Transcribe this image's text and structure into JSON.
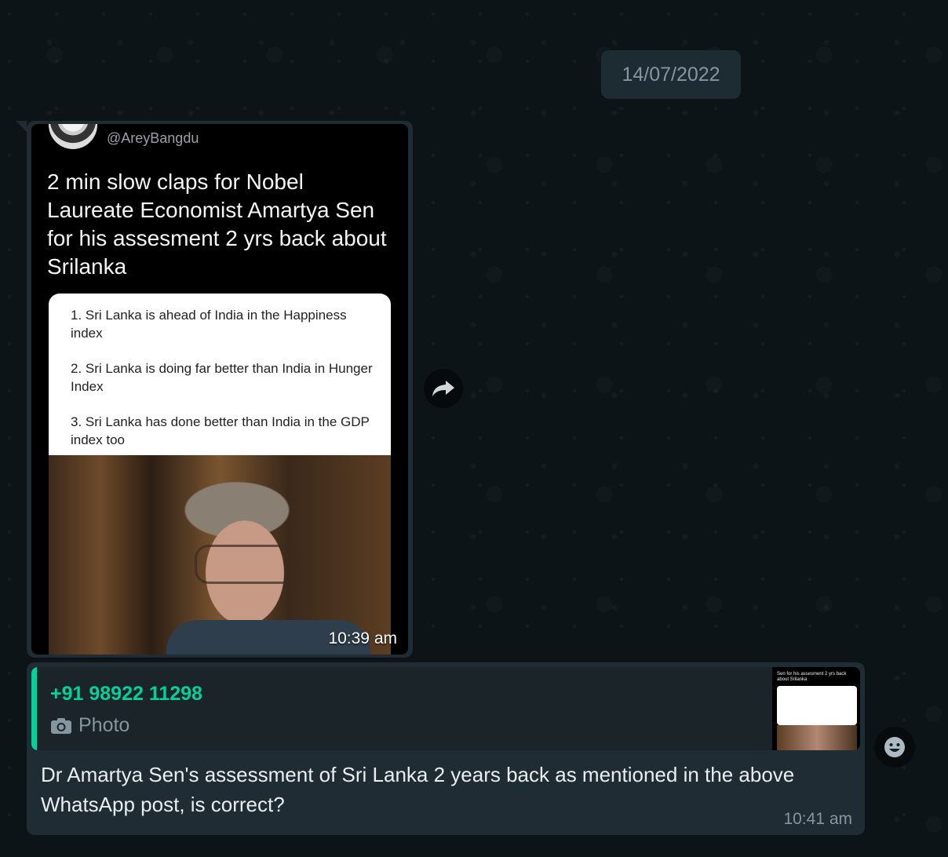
{
  "date_separator": "14/07/2022",
  "image_message": {
    "handle": "@AreyBangdu",
    "tweet_text": "2 min slow claps for Nobel Laureate Economist Amartya Sen for his assesment 2 yrs back about Srilanka",
    "quote_items": [
      "1. Sri Lanka is ahead of India in the Happiness index",
      "2. Sri Lanka is doing far better than India in Hunger Index",
      "3. Sri Lanka has done better than India in the GDP index too"
    ],
    "time": "10:39 am"
  },
  "reply_message": {
    "quoted_author": "+91 98922 11298",
    "quoted_type": "Photo",
    "thumb_text": "Sen for his assesment 2 yrs back about Srilanka",
    "text": "Dr Amartya Sen's assessment of Sri Lanka 2 years back as mentioned in the above WhatsApp post, is correct?",
    "time": "10:41 am"
  },
  "icons": {
    "forward": "forward-icon",
    "camera": "camera-icon",
    "emoji": "emoji-icon"
  },
  "colors": {
    "accent": "#06cf9c",
    "bubble": "#202c33",
    "background": "#0c1418"
  }
}
